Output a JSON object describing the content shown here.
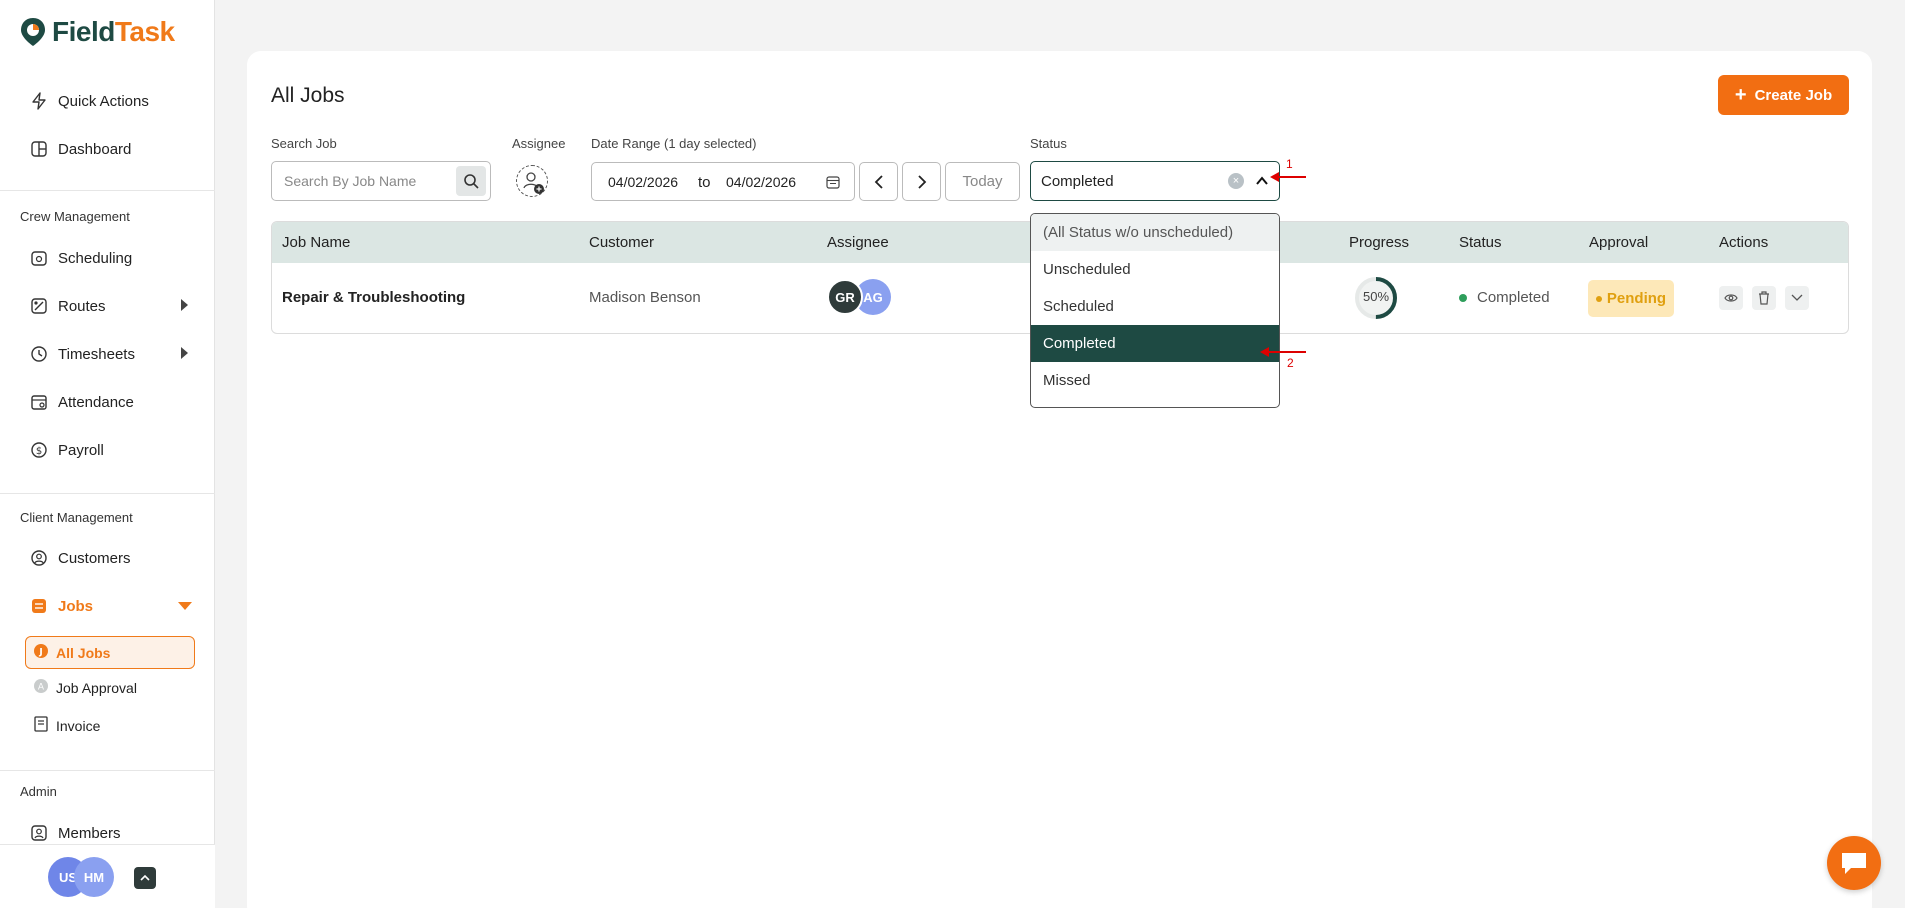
{
  "app": {
    "logo_a": "Field",
    "logo_b": "Task"
  },
  "sidebar": {
    "quick_actions": "Quick Actions",
    "dashboard": "Dashboard",
    "crew_management": "Crew Management",
    "scheduling": "Scheduling",
    "routes": "Routes",
    "timesheets": "Timesheets",
    "attendance": "Attendance",
    "payroll": "Payroll",
    "client_management": "Client Management",
    "customers": "Customers",
    "jobs": "Jobs",
    "all_jobs": "All Jobs",
    "job_approval": "Job Approval",
    "invoice": "Invoice",
    "admin": "Admin",
    "members": "Members",
    "user_avatars": [
      "US",
      "HM"
    ]
  },
  "header": {
    "title": "All Jobs",
    "create_button": "Create Job"
  },
  "filters": {
    "search_label": "Search Job",
    "search_placeholder": "Search By Job Name",
    "assignee_label": "Assignee",
    "date_range_label": "Date Range (1 day selected)",
    "date_from": "04/02/2026",
    "date_to_word": "to",
    "date_to": "04/02/2026",
    "today_button": "Today",
    "status_label": "Status",
    "status_value": "Completed"
  },
  "table": {
    "headers": [
      "Job Name",
      "Customer",
      "Assignee",
      "Progress",
      "Status",
      "Approval",
      "Actions"
    ],
    "rows": [
      {
        "job_name": "Repair & Troubleshooting",
        "customer": "Madison Benson",
        "assignees": [
          "GR",
          "AG"
        ],
        "progress": "50%",
        "progress_value": 0.5,
        "status": "Completed",
        "approval": "Pending"
      }
    ]
  },
  "status_dropdown": {
    "options": [
      "(All Status w/o unscheduled)",
      "Unscheduled",
      "Scheduled",
      "Completed",
      "Missed"
    ],
    "selected": "Completed"
  },
  "annotations": [
    "1",
    "2"
  ],
  "colors": {
    "brand_green": "#1e4a43",
    "brand_orange": "#f26e12",
    "status_completed": "#2e9e5b",
    "pending_bg": "#fde8b8"
  }
}
